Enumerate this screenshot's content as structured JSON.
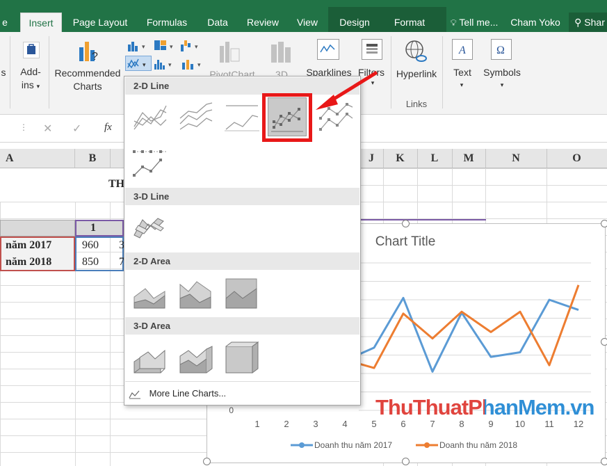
{
  "tabs": [
    {
      "label": "e",
      "active": false
    },
    {
      "label": "Insert",
      "active": true
    },
    {
      "label": "Page Layout",
      "active": false
    },
    {
      "label": "Formulas",
      "active": false
    },
    {
      "label": "Data",
      "active": false
    },
    {
      "label": "Review",
      "active": false
    },
    {
      "label": "View",
      "active": false
    },
    {
      "label": "Design",
      "active": false
    },
    {
      "label": "Format",
      "active": false
    }
  ],
  "tell_me": "Tell me...",
  "user_name": "Cham Yoko",
  "share_label": "Shar",
  "ribbon": {
    "addins_line1": "Add-",
    "addins_line2": "ins",
    "recommended_line1": "Recommended",
    "recommended_line2": "Charts",
    "pivotchart": "PivotChart",
    "threed": "3D",
    "sparklines": "Sparklines",
    "filters": "Filters",
    "hyperlink": "Hyperlink",
    "links_group": "Links",
    "text": "Text",
    "symbols": "Symbols"
  },
  "formula_bar": {
    "fx": "fx",
    "cancel": "✕",
    "enter": "✓"
  },
  "columns": [
    "A",
    "B",
    "J",
    "K",
    "L",
    "M",
    "N",
    "O"
  ],
  "cells": {
    "title_fragment": "TH",
    "header_col1": "1",
    "row1_label": "năm 2017",
    "row1_val": "960",
    "row1_val2": "3",
    "row2_label": "năm 2018",
    "row2_val": "850",
    "row2_val2": "7"
  },
  "dropdown": {
    "sec_2d_line": "2-D Line",
    "sec_3d_line": "3-D Line",
    "sec_2d_area": "2-D Area",
    "sec_3d_area": "3-D Area",
    "more": "More Line Charts..."
  },
  "chart_data": {
    "type": "line",
    "title": "Chart Title",
    "x": [
      1,
      2,
      3,
      4,
      5,
      6,
      7,
      8,
      9,
      10,
      11,
      12
    ],
    "x_visible_from": 5,
    "series": [
      {
        "name": "Doanh thu năm 2017",
        "color": "#5B9BD5",
        "values": [
          null,
          null,
          null,
          540,
          680,
          1220,
          420,
          1060,
          580,
          630,
          1200,
          1090
        ]
      },
      {
        "name": "Doanh thu năm 2018",
        "color": "#ED7D31",
        "values": [
          null,
          null,
          null,
          550,
          460,
          1050,
          780,
          1070,
          850,
          1070,
          490,
          1360
        ]
      }
    ],
    "ylim": [
      0,
      1600
    ],
    "y_tick_visible": "0",
    "legend": "bottom",
    "grid": true
  },
  "watermark": "ThuThuatPhanMem.vn",
  "colors": {
    "excel_green": "#217346",
    "highlight_red": "#e81818",
    "series_blue": "#5B9BD5",
    "series_orange": "#ED7D31"
  }
}
